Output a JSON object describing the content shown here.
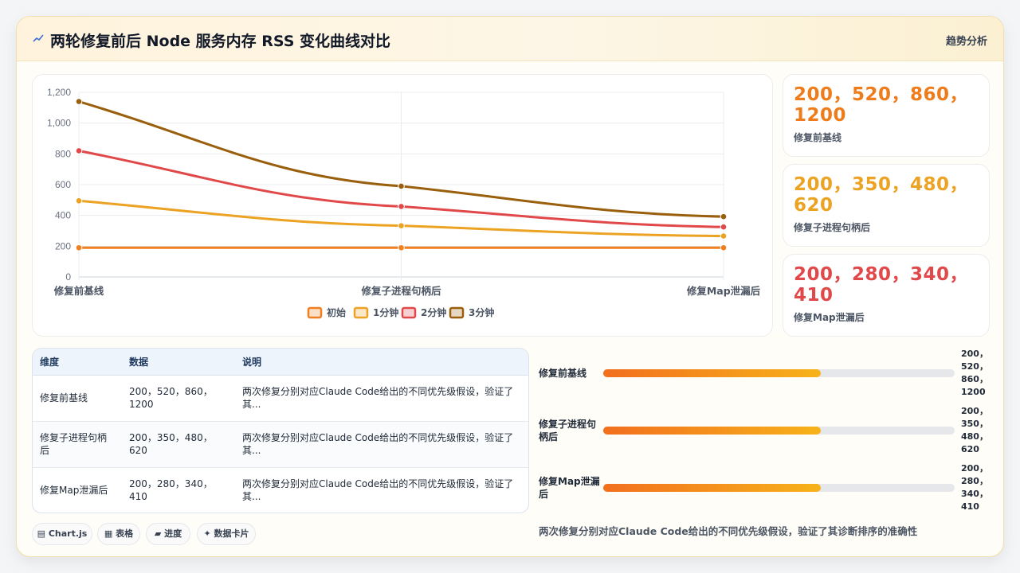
{
  "header": {
    "title": "两轮修复前后 Node 服务内存 RSS 变化曲线对比",
    "tag": "趋势分析"
  },
  "colors": {
    "orange": "#f07f20",
    "amber": "#eca223",
    "red": "#e1484a",
    "brown": "#9a5f0c"
  },
  "chart_data": {
    "type": "line",
    "x": [
      "修复前基线",
      "修复子进程句柄后",
      "修复Map泄漏后"
    ],
    "ylim": [
      0,
      1200
    ],
    "yticks": [
      "0",
      "200",
      "400",
      "600",
      "800",
      "1,000",
      "1,200"
    ],
    "grid": true,
    "legend_position": "bottom",
    "series": [
      {
        "name": "初始",
        "values": [
          190,
          190,
          190
        ],
        "color": "#f07f20"
      },
      {
        "name": "1分钟",
        "values": [
          495,
          333,
          266
        ],
        "color": "#eca223"
      },
      {
        "name": "2分钟",
        "values": [
          820,
          458,
          325
        ],
        "color": "#e1484a"
      },
      {
        "name": "3分钟",
        "values": [
          1140,
          590,
          392
        ],
        "color": "#9a5f0c"
      }
    ]
  },
  "stats": [
    {
      "value": "200，520，860，1200",
      "label": "修复前基线",
      "color": "#ef7c1b"
    },
    {
      "value": "200，350，480，620",
      "label": "修复子进程句柄后",
      "color": "#eca223"
    },
    {
      "value": "200，280，340，410",
      "label": "修复Map泄漏后",
      "color": "#e1484a"
    }
  ],
  "table": {
    "headers": [
      "维度",
      "数据",
      "说明"
    ],
    "rows": [
      {
        "dim": "修复前基线",
        "data": "200，520，860，1200",
        "desc": "两次修复分别对应Claude Code给出的不同优先级假设，验证了其..."
      },
      {
        "dim": "修复子进程句柄后",
        "data": "200，350，480，620",
        "desc": "两次修复分别对应Claude Code给出的不同优先级假设，验证了其..."
      },
      {
        "dim": "修复Map泄漏后",
        "data": "200，280，340，410",
        "desc": "两次修复分别对应Claude Code给出的不同优先级假设，验证了其..."
      }
    ]
  },
  "chips": [
    "▤ Chart.js",
    "▦ 表格",
    "▰ 进度",
    "✦ 数据卡片"
  ],
  "progress": [
    {
      "label": "修复前基线",
      "value": "200，520，860，1200",
      "fraction": 0.62
    },
    {
      "label": "修复子进程句柄后",
      "value": "200，350，480，620",
      "fraction": 0.62
    },
    {
      "label": "修复Map泄漏后",
      "value": "200，280，340，410",
      "fraction": 0.62
    }
  ],
  "footer_note": "两次修复分别对应Claude Code给出的不同优先级假设，验证了其诊断排序的准确性"
}
